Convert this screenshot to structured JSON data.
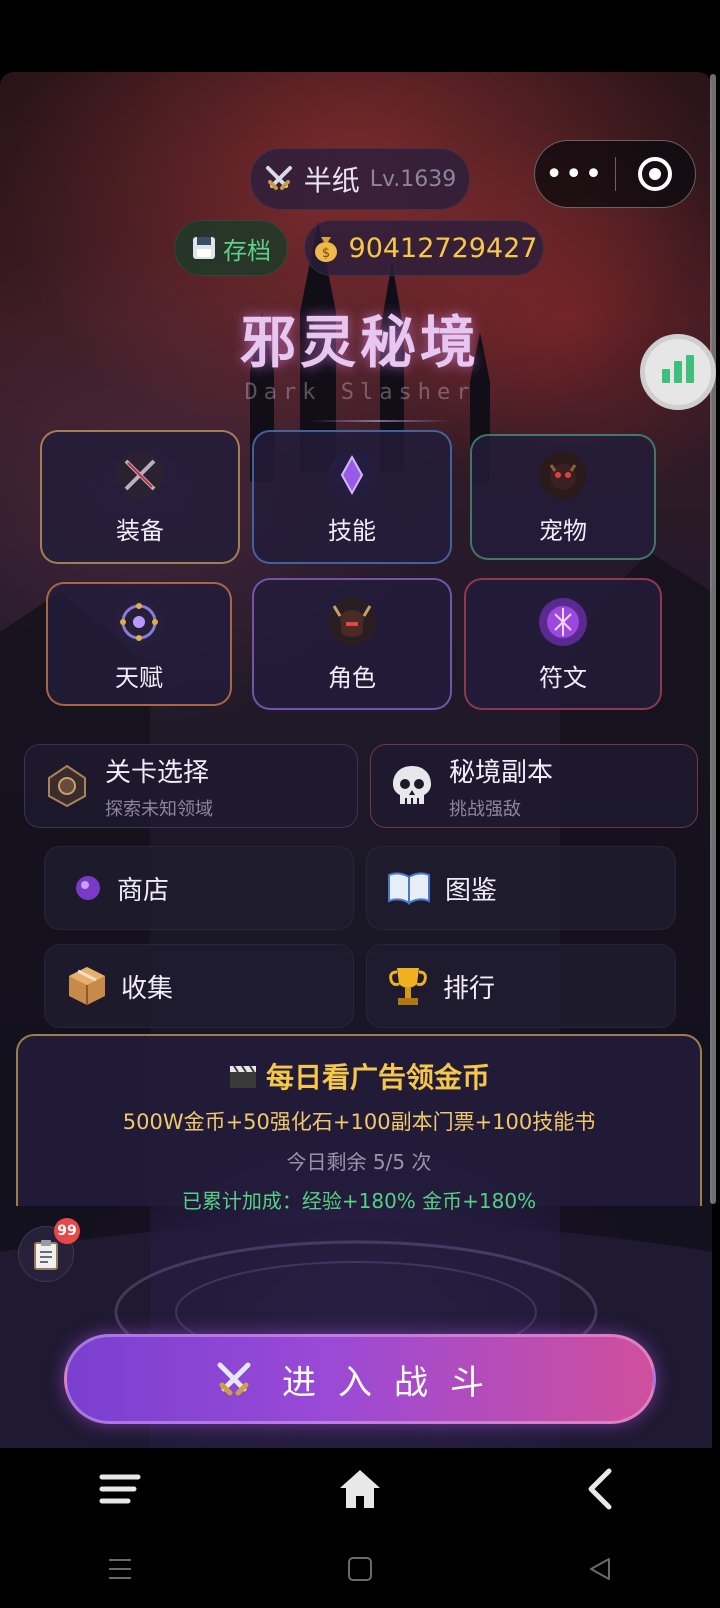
{
  "player": {
    "name": "半纸",
    "level": "Lv.1639"
  },
  "save": {
    "label": "存档"
  },
  "gold": {
    "amount": "90412729427"
  },
  "capsule": {
    "more": "•••"
  },
  "game": {
    "title": "邪灵秘境",
    "subtitle": "Dark Slasher"
  },
  "tiles": [
    {
      "label": "装备",
      "icon": "crossed-swords-icon"
    },
    {
      "label": "技能",
      "icon": "magic-crystal-icon"
    },
    {
      "label": "宠物",
      "icon": "demon-pet-icon"
    },
    {
      "label": "天赋",
      "icon": "talent-tree-icon"
    },
    {
      "label": "角色",
      "icon": "horned-helmet-icon"
    },
    {
      "label": "符文",
      "icon": "rune-orb-icon"
    }
  ],
  "stage_select": {
    "title": "关卡选择",
    "sub": "探索未知领域"
  },
  "dungeon": {
    "title": "秘境副本",
    "sub": "挑战强敌"
  },
  "menu": [
    {
      "label": "商店"
    },
    {
      "label": "图鉴"
    },
    {
      "label": "收集"
    },
    {
      "label": "排行"
    }
  ],
  "ad": {
    "title": "每日看广告领金币",
    "rewards": "500W金币+50强化石+100副本门票+100技能书",
    "remaining": "今日剩余 5/5 次",
    "bonus": "已累计加成：经验+180%  金币+180%"
  },
  "tasks": {
    "badge": "99"
  },
  "battle": {
    "label": "进入战斗"
  },
  "colors": {
    "accent": "#9a4ad6",
    "gold": "#f5c84a",
    "green": "#57cf84"
  }
}
